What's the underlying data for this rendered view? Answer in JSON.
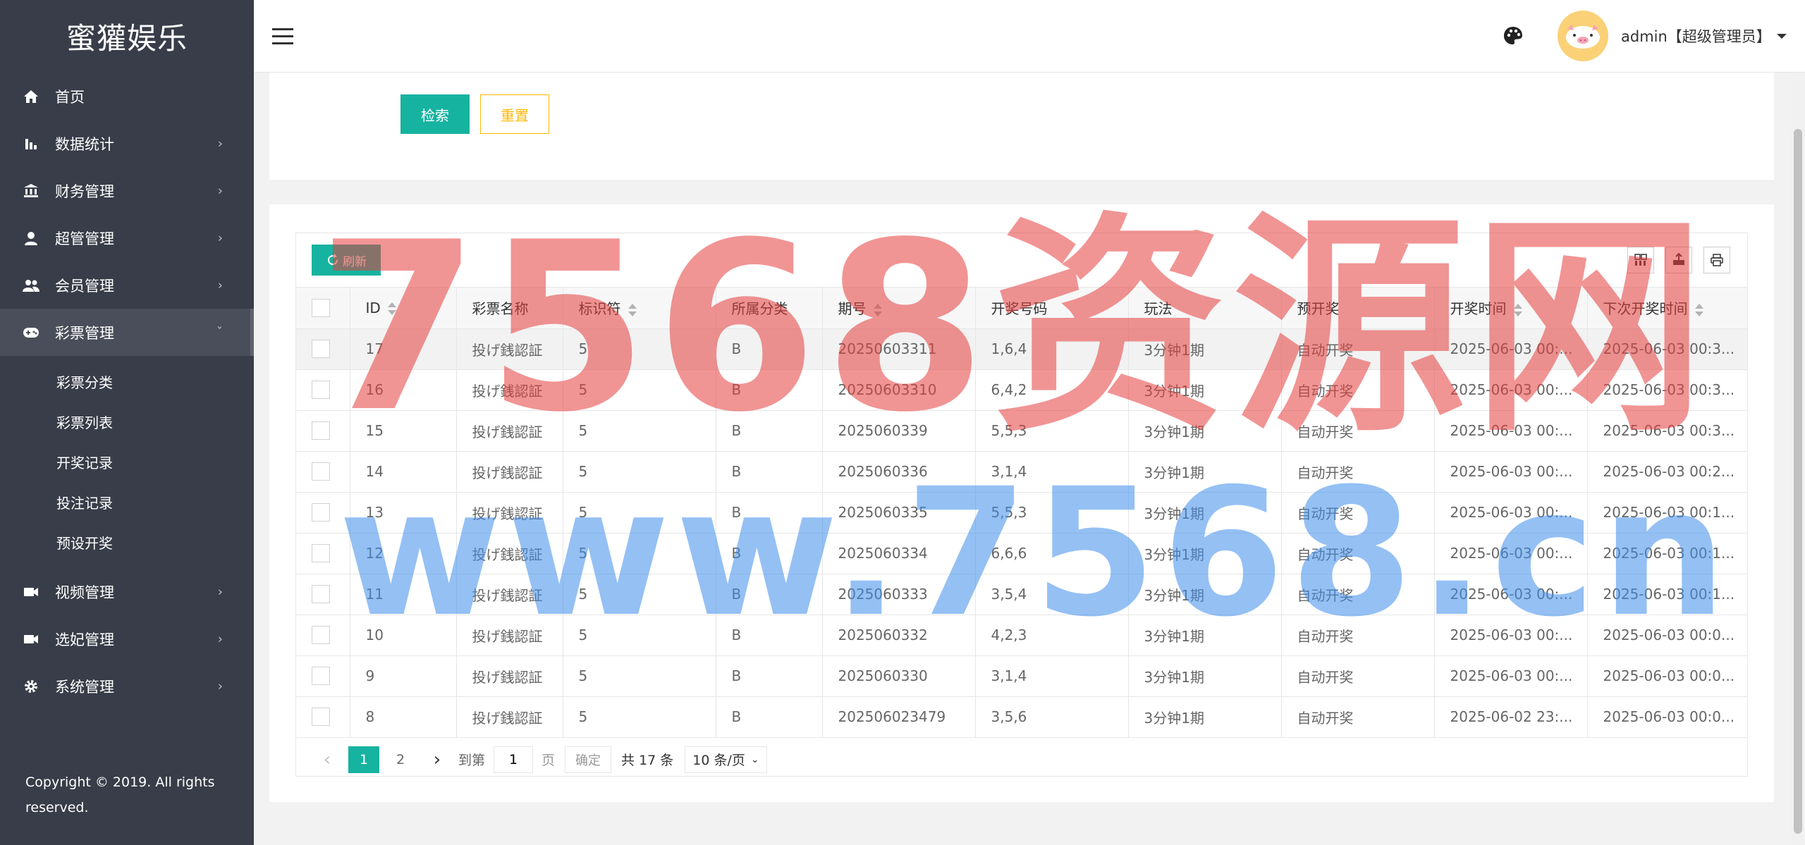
{
  "sidebar": {
    "logo": "蜜獾娱乐",
    "items": [
      {
        "label": "首页"
      },
      {
        "label": "数据统计"
      },
      {
        "label": "财务管理"
      },
      {
        "label": "超管管理"
      },
      {
        "label": "会员管理"
      },
      {
        "label": "彩票管理"
      },
      {
        "label": "视频管理"
      },
      {
        "label": "选妃管理"
      },
      {
        "label": "系统管理"
      }
    ],
    "submenu": [
      "彩票分类",
      "彩票列表",
      "开奖记录",
      "投注记录",
      "预设开奖"
    ],
    "copyright": "Copyright © 2019. All rights reserved."
  },
  "header": {
    "username": "admin【超级管理员】"
  },
  "search": {
    "search_label": "检索",
    "reset_label": "重置"
  },
  "toolbar": {
    "refresh_label": "刷新"
  },
  "table": {
    "columns": [
      "ID",
      "彩票名称",
      "标识符",
      "所属分类",
      "期号",
      "开奖号码",
      "玩法",
      "预开奖",
      "开奖时间",
      "下次开奖时间"
    ],
    "rows": [
      [
        "17",
        "投げ銭認証",
        "5",
        "B",
        "20250603311",
        "1,6,4",
        "3分钟1期",
        "自动开奖",
        "2025-06-03 00:...",
        "2025-06-03 00:3..."
      ],
      [
        "16",
        "投げ銭認証",
        "5",
        "B",
        "20250603310",
        "6,4,2",
        "3分钟1期",
        "自动开奖",
        "2025-06-03 00:...",
        "2025-06-03 00:3..."
      ],
      [
        "15",
        "投げ銭認証",
        "5",
        "B",
        "2025060339",
        "5,5,3",
        "3分钟1期",
        "自动开奖",
        "2025-06-03 00:...",
        "2025-06-03 00:3..."
      ],
      [
        "14",
        "投げ銭認証",
        "5",
        "B",
        "2025060336",
        "3,1,4",
        "3分钟1期",
        "自动开奖",
        "2025-06-03 00:...",
        "2025-06-03 00:2..."
      ],
      [
        "13",
        "投げ銭認証",
        "5",
        "B",
        "2025060335",
        "5,5,3",
        "3分钟1期",
        "自动开奖",
        "2025-06-03 00:...",
        "2025-06-03 00:1..."
      ],
      [
        "12",
        "投げ銭認証",
        "5",
        "B",
        "2025060334",
        "6,6,6",
        "3分钟1期",
        "自动开奖",
        "2025-06-03 00:...",
        "2025-06-03 00:1..."
      ],
      [
        "11",
        "投げ銭認証",
        "5",
        "B",
        "2025060333",
        "3,5,4",
        "3分钟1期",
        "自动开奖",
        "2025-06-03 00:...",
        "2025-06-03 00:1..."
      ],
      [
        "10",
        "投げ銭認証",
        "5",
        "B",
        "2025060332",
        "4,2,3",
        "3分钟1期",
        "自动开奖",
        "2025-06-03 00:...",
        "2025-06-03 00:0..."
      ],
      [
        "9",
        "投げ銭認証",
        "5",
        "B",
        "2025060330",
        "3,1,4",
        "3分钟1期",
        "自动开奖",
        "2025-06-03 00:...",
        "2025-06-03 00:0..."
      ],
      [
        "8",
        "投げ銭認証",
        "5",
        "B",
        "202506023479",
        "3,5,6",
        "3分钟1期",
        "自动开奖",
        "2025-06-02 23:...",
        "2025-06-03 00:0..."
      ]
    ]
  },
  "pager": {
    "pages": [
      "1",
      "2"
    ],
    "goto_label": "到第",
    "goto_value": "1",
    "page_label": "页",
    "confirm_label": "确定",
    "total_label": "共 17 条",
    "page_size_label": "10 条/页"
  },
  "watermark": {
    "line1": "7568资源网",
    "line2": "www.7568.cn"
  }
}
